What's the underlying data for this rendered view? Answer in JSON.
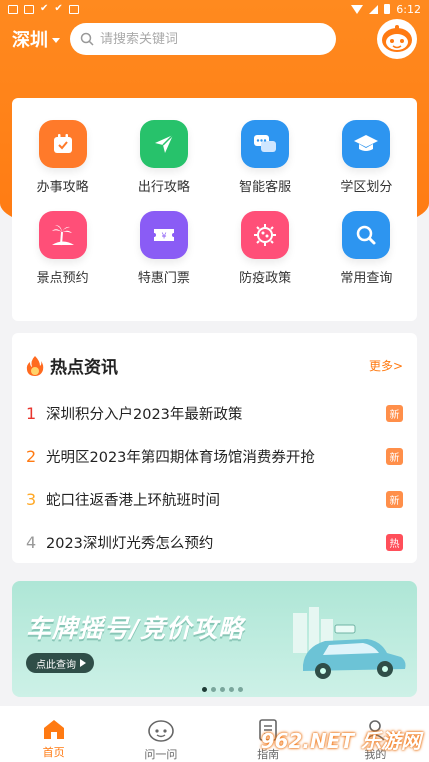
{
  "status_bar": {
    "time": "6:12"
  },
  "header": {
    "city": "深圳",
    "search_placeholder": "请搜索关键词"
  },
  "services": [
    {
      "label": "办事攻略",
      "icon": "calendar-check-icon",
      "color": "#ff7a2a"
    },
    {
      "label": "出行攻略",
      "icon": "send-arrow-icon",
      "color": "#27c26b"
    },
    {
      "label": "智能客服",
      "icon": "chat-bubbles-icon",
      "color": "#2d95f0"
    },
    {
      "label": "学区划分",
      "icon": "graduation-cap-icon",
      "color": "#2d95f0"
    },
    {
      "label": "景点预约",
      "icon": "palm-tree-icon",
      "color": "#ff4f78"
    },
    {
      "label": "特惠门票",
      "icon": "ticket-icon",
      "color": "#8a5cf5"
    },
    {
      "label": "防疫政策",
      "icon": "virus-icon",
      "color": "#ff4f78"
    },
    {
      "label": "常用查询",
      "icon": "magnifier-icon",
      "color": "#2d95f0"
    }
  ],
  "news": {
    "title": "热点资讯",
    "more": "更多>",
    "items": [
      {
        "rank": "1",
        "text": "深圳积分入户2023年最新政策",
        "badge": "新",
        "rank_color": "#e8352e",
        "badge_color": "#ff8f4a"
      },
      {
        "rank": "2",
        "text": "光明区2023年第四期体育场馆消费券开抢",
        "badge": "新",
        "rank_color": "#ff7a12",
        "badge_color": "#ff8f4a"
      },
      {
        "rank": "3",
        "text": "蛇口往返香港上环航班时间",
        "badge": "新",
        "rank_color": "#ffa826",
        "badge_color": "#ff8f4a"
      },
      {
        "rank": "4",
        "text": "2023深圳灯光秀怎么预约",
        "badge": "热",
        "rank_color": "#999999",
        "badge_color": "#ff4f5a"
      }
    ]
  },
  "banner": {
    "title": "车牌摇号/竞价攻略",
    "button": "点此查询"
  },
  "tabs": [
    {
      "label": "首页",
      "icon": "home-icon",
      "active": true
    },
    {
      "label": "问一问",
      "icon": "robot-face-icon",
      "active": false
    },
    {
      "label": "指南",
      "icon": "document-icon",
      "active": false
    },
    {
      "label": "我的",
      "icon": "user-icon",
      "active": false
    }
  ],
  "watermark": "962.NET 乐游网",
  "colors": {
    "brand": "#ff7a12"
  }
}
